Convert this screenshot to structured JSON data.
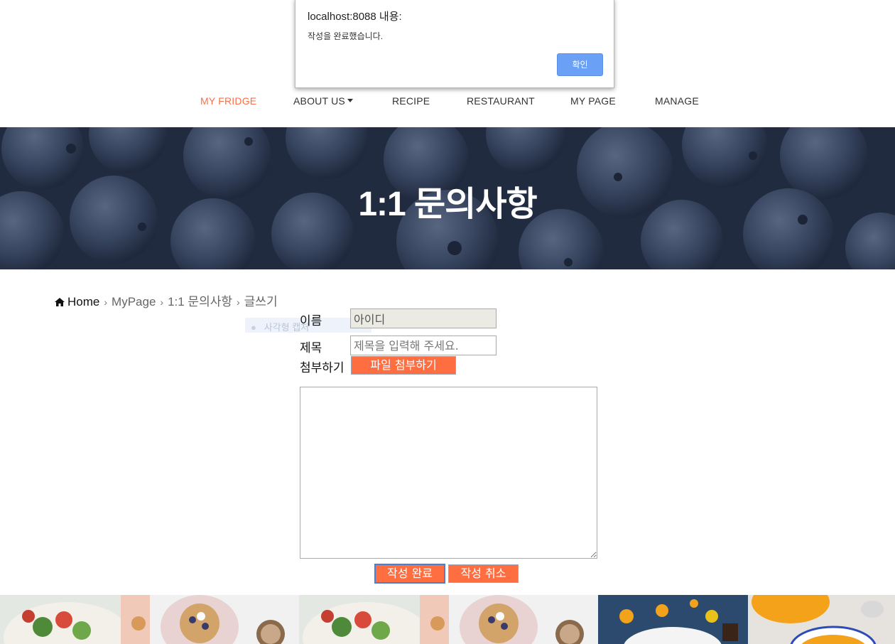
{
  "nav": {
    "items": [
      {
        "label": "MY FRIDGE",
        "active": true
      },
      {
        "label": "ABOUT US",
        "dropdown": true
      },
      {
        "label": "RECIPE"
      },
      {
        "label": "RESTAURANT"
      },
      {
        "label": "MY PAGE"
      },
      {
        "label": "MANAGE"
      }
    ]
  },
  "hero": {
    "title": "1:1 문의사항"
  },
  "breadcrumb": {
    "home": "Home",
    "items": [
      "MyPage",
      "1:1 문의사항",
      "글쓰기"
    ]
  },
  "ghost_tooltip": "사각형 캡처",
  "form": {
    "name_label": "이름",
    "name_value": "아이디",
    "title_label": "제목",
    "title_placeholder": "제목을 입력해 주세요.",
    "attach_label": "첨부하기",
    "attach_button": "파일 첨부하기",
    "content_value": "",
    "submit_button": "작성 완료",
    "cancel_button": "작성 취소"
  },
  "dialog": {
    "title": "localhost:8088 내용:",
    "message": "작성을 완료했습니다.",
    "ok_button": "확인"
  },
  "colors": {
    "accent": "#f86f4a",
    "button_orange": "#ff6e40",
    "dialog_ok": "#6aa0f5",
    "hero_bg": "#2e3a52"
  },
  "footer_images": [
    "salad-bowl",
    "waffle-coffee",
    "salad-bowl",
    "waffle-coffee",
    "fruit-bowl",
    "soup-bowl"
  ]
}
